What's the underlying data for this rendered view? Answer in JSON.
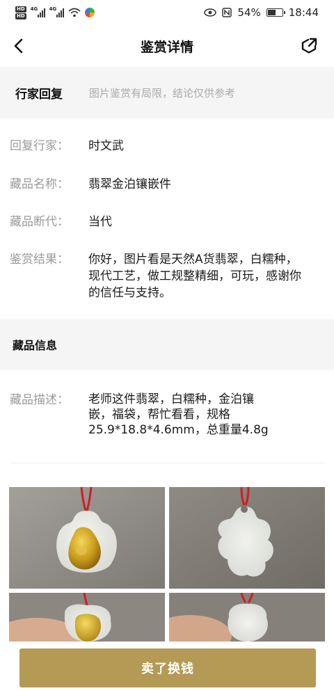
{
  "status_bar": {
    "hd1": "HD",
    "hd2": "HD",
    "net1": "4G",
    "net2": "4G",
    "battery": "54%",
    "time": "18:44",
    "battery_level": 0.54
  },
  "header": {
    "title": "鉴赏详情",
    "back_icon": "chevron-left-icon",
    "share_icon": "share-icon"
  },
  "reply_section": {
    "label": "行家回复",
    "note": "图片鉴赏有局限，结论仅供参考"
  },
  "reply_rows": [
    {
      "key": "回复行家：",
      "value": "时文武"
    },
    {
      "key": "藏品名称：",
      "value": "翡翠金泊镶嵌件"
    },
    {
      "key": "藏品断代：",
      "value": "当代"
    },
    {
      "key": "鉴赏结果：",
      "value": "你好，图片看是天然A货翡翠，白糯种，现代工艺，做工规整精细，可玩，感谢你的信任与支持。"
    }
  ],
  "info_section": {
    "label": "藏品信息"
  },
  "info_rows": [
    {
      "key": "藏品描述：",
      "value": "老师这件翡翠，白糯种，金泊镶嵌，福袋，帮忙看看，规格25.9*18.8*4.6mm，总重量4.8g"
    }
  ],
  "bottom": {
    "sell_button": "卖了换钱"
  },
  "colors": {
    "accent_gold": "#b49a55",
    "section_bg": "#f5f5f5",
    "label_gray": "#9a9a9a"
  }
}
